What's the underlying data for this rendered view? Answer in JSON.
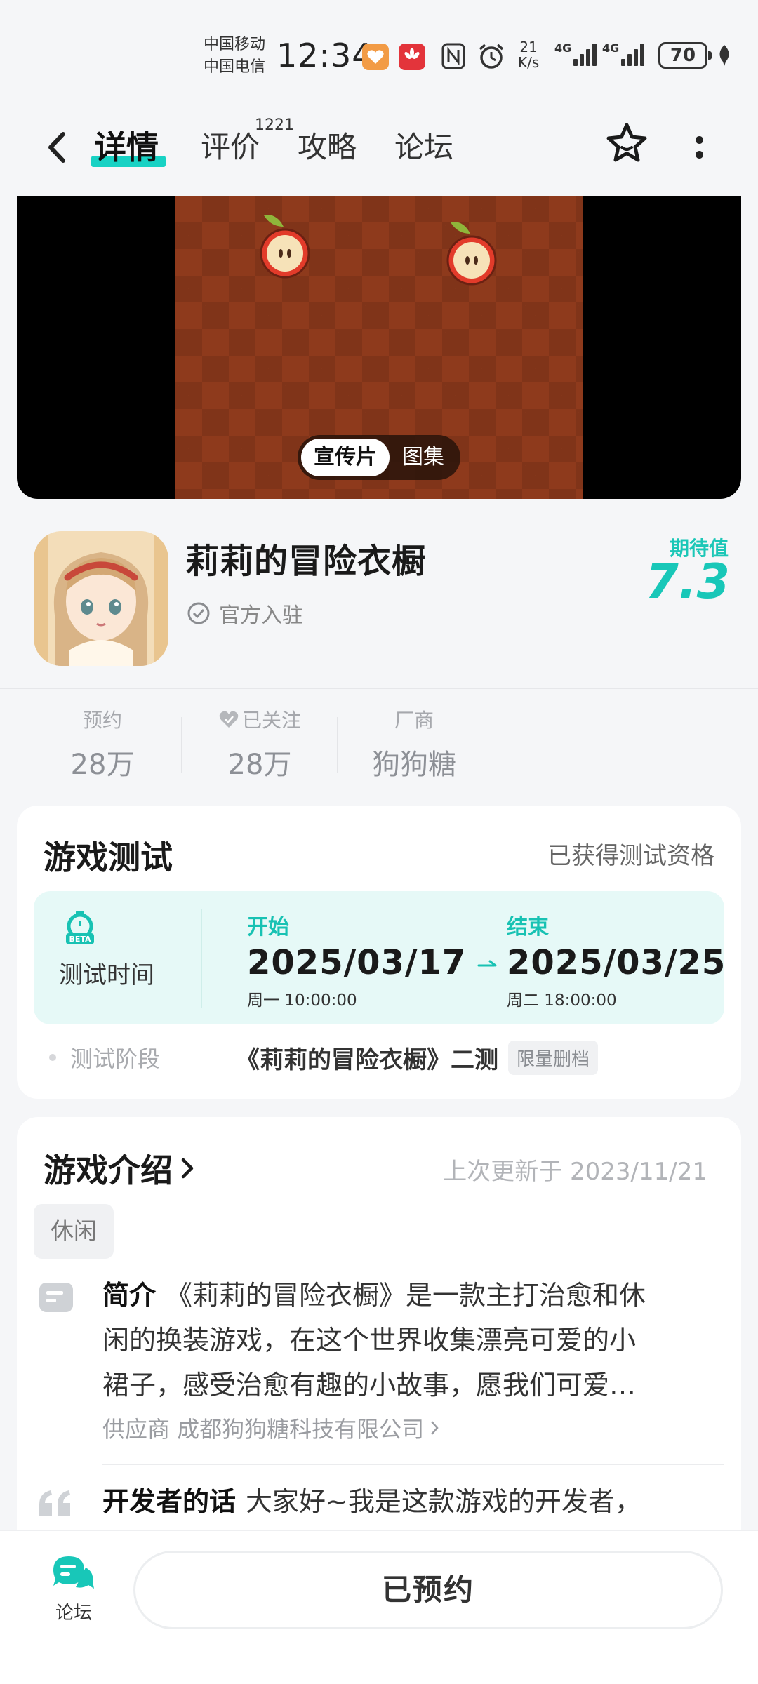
{
  "status_bar": {
    "carrier_1": "中国移动",
    "carrier_2": "中国电信",
    "time": "12:34",
    "net_speed_value": "21",
    "net_speed_unit": "K/s",
    "signal_1": "4G",
    "signal_2": "4G",
    "battery": "70"
  },
  "nav": {
    "tabs": [
      {
        "label": "详情"
      },
      {
        "label": "评价"
      },
      {
        "label": "攻略"
      },
      {
        "label": "论坛"
      }
    ],
    "review_count": "1221",
    "active_tab": "详情"
  },
  "media": {
    "switch": [
      "宣传片",
      "图集"
    ],
    "selected": "宣传片"
  },
  "game": {
    "title": "莉莉的冒险衣橱",
    "official_badge": "官方入驻",
    "expect_label": "期待值",
    "expect_value": "7.3"
  },
  "stats": [
    {
      "label": "预约",
      "value": "28万"
    },
    {
      "label": "已关注",
      "value": "28万"
    },
    {
      "label": "厂商",
      "value": "狗狗糖"
    }
  ],
  "test": {
    "title": "游戏测试",
    "status": "已获得测试资格",
    "time_label": "测试时间",
    "start_label": "开始",
    "start_date": "2025/03/17",
    "start_time": "周一  10:00:00",
    "end_label": "结束",
    "end_date": "2025/03/25",
    "end_time": "周二  18:00:00",
    "phase_label": "测试阶段",
    "phase_name": "《莉莉的冒险衣橱》二测",
    "phase_badge": "限量删档"
  },
  "intro": {
    "title": "游戏介绍",
    "updated": "上次更新于 2023/11/21",
    "tag": "休闲",
    "summary_lead": "简介",
    "summary_line1": "《莉莉的冒险衣橱》是一款主打治愈和休",
    "summary_line2": "闲的换装游戏，在这个世界收集漂亮可爱的小",
    "summary_line3": "裙子，感受治愈有趣的小故事，愿我们可爱…",
    "supplier": "供应商 成都狗狗糖科技有限公司",
    "dev_lead": "开发者的话",
    "dev_text": "大家好~我是这款游戏的开发者，"
  },
  "bottom": {
    "forum_label": "论坛",
    "reserve_label": "已预约"
  },
  "colors": {
    "accent": "#18d2c4",
    "expect": "#18c7b8",
    "test_box_bg": "#e6f9f7",
    "banner_bg": "#8e3a1c"
  }
}
